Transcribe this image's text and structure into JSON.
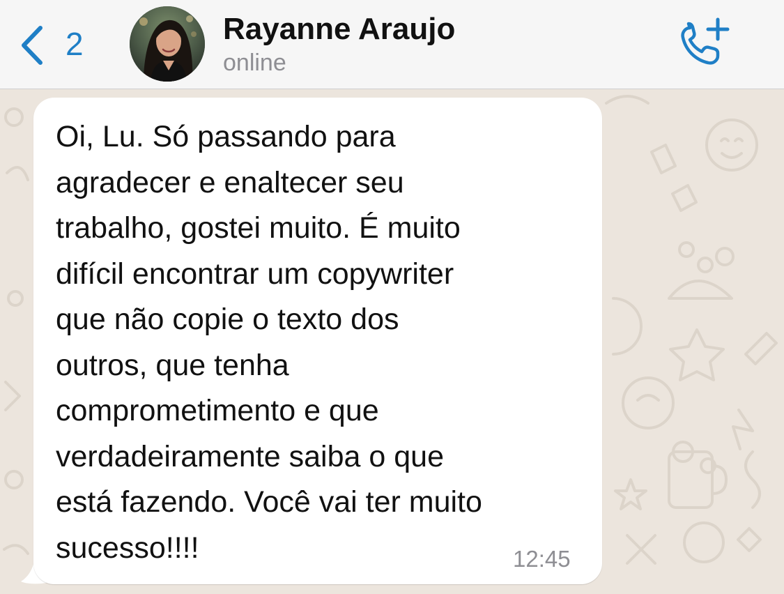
{
  "header": {
    "back_count": "2",
    "contact_name": "Rayanne Araujo",
    "status": "online",
    "icons": {
      "back": "chevron-left-icon",
      "call": "phone-add-icon"
    },
    "accent_color": "#1f7fc6"
  },
  "chat": {
    "wallpaper_color": "#ece5dd",
    "bubble_color": "#ffffff",
    "messages": [
      {
        "direction": "incoming",
        "text": "Oi, Lu. Só passando para\nagradecer e enaltecer seu\ntrabalho, gostei muito. É muito\ndifícil encontrar um copywriter\nque não copie o texto dos\noutros, que tenha\ncomprometimento e que\nverdadeiramente saiba o que\nestá fazendo. Você vai ter muito\nsucesso!!!!",
        "time": "12:45"
      }
    ]
  }
}
